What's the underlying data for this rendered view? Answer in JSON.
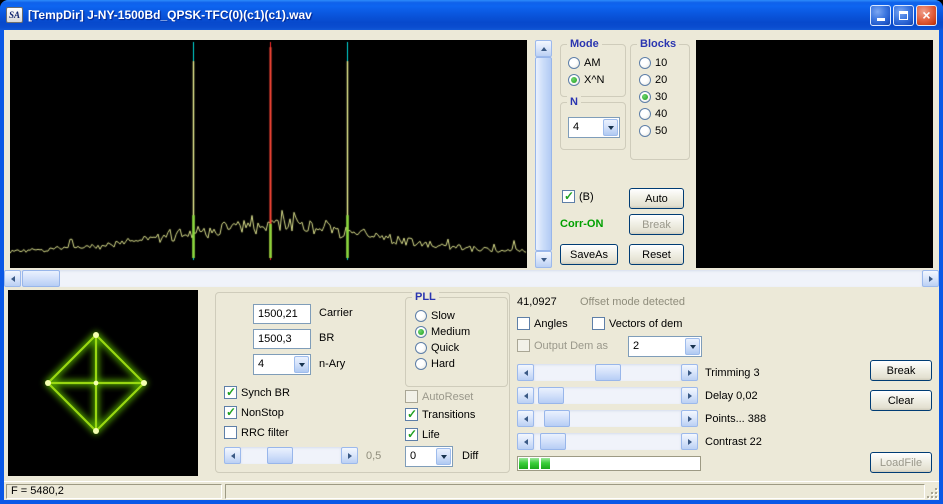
{
  "window": {
    "icon_text": "SA",
    "title": "[TempDir] J-NY-1500Bd_QPSK-TFC(0)(c1)(c1).wav"
  },
  "top": {
    "mode": {
      "label": "Mode",
      "options": [
        {
          "label": "AM",
          "selected": false
        },
        {
          "label": "X^N",
          "selected": true
        }
      ]
    },
    "blocks": {
      "label": "Blocks",
      "options": [
        {
          "label": "10",
          "selected": false
        },
        {
          "label": "20",
          "selected": false
        },
        {
          "label": "30",
          "selected": true
        },
        {
          "label": "40",
          "selected": false
        },
        {
          "label": "50",
          "selected": false
        }
      ]
    },
    "n": {
      "label": "N",
      "value": "4"
    },
    "b_checkbox": {
      "label": "(B)",
      "checked": true
    },
    "auto_button": "Auto",
    "corr_status": "Corr-ON",
    "break_button": "Break",
    "saveas_button": "SaveAs",
    "reset_button": "Reset"
  },
  "spectrum": {
    "background": "#000000",
    "trace_color": "#D8DD8A",
    "markers": [
      {
        "x_frac": 0.354,
        "color": "#00D8D8"
      },
      {
        "x_frac": 0.503,
        "color": "#FF2A2A"
      },
      {
        "x_frac": 0.652,
        "color": "#00D8D8"
      }
    ],
    "peaks": [
      {
        "x_frac": 0.354,
        "h_frac": 0.92,
        "color": "#E8EE90",
        "width": 1.5
      },
      {
        "x_frac": 0.652,
        "h_frac": 0.92,
        "color": "#E8EE90",
        "width": 1.5
      },
      {
        "x_frac": 0.503,
        "h_frac": 0.985,
        "color": "#FF4838",
        "width": 2
      },
      {
        "x_frac": 0.354,
        "h_frac": 0.2,
        "color": "#8ADA3C",
        "width": 2.5
      },
      {
        "x_frac": 0.652,
        "h_frac": 0.2,
        "color": "#8ADA3C",
        "width": 2.5
      },
      {
        "x_frac": 0.503,
        "h_frac": 0.16,
        "color": "#8ADA3C",
        "width": 2.5
      }
    ]
  },
  "demod": {
    "carrier": {
      "value": "1500,21",
      "label": "Carrier"
    },
    "br": {
      "value": "1500,3",
      "label": "BR"
    },
    "nary": {
      "value": "4",
      "label": "n-Ary"
    },
    "synch_br": {
      "label": "Synch BR",
      "checked": true
    },
    "nonstop": {
      "label": "NonStop",
      "checked": true
    },
    "rrc": {
      "label": "RRC filter",
      "checked": false
    },
    "gain_slider": {
      "value_label": "0,5",
      "thumb_frac": 0.35
    },
    "pll": {
      "label": "PLL",
      "options": [
        {
          "label": "Slow",
          "selected": false
        },
        {
          "label": "Medium",
          "selected": true
        },
        {
          "label": "Quick",
          "selected": false
        },
        {
          "label": "Hard",
          "selected": false
        }
      ]
    },
    "autoreset": {
      "label": "AutoReset",
      "checked": false,
      "disabled": true
    },
    "transitions": {
      "label": "Transitions",
      "checked": true
    },
    "life": {
      "label": "Life",
      "checked": true
    },
    "diff": {
      "value": "0",
      "label": "Diff"
    }
  },
  "right": {
    "offset_value": "41,0927",
    "offset_note": "Offset mode detected",
    "angles": {
      "label": "Angles",
      "checked": false
    },
    "vectors": {
      "label": "Vectors of dem",
      "checked": false
    },
    "output_dem": {
      "label": "Output Dem as",
      "value": "2",
      "disabled": true
    },
    "sliders": [
      {
        "label": "Trimming 3",
        "thumb_frac": 0.5
      },
      {
        "label": "Delay  0,02",
        "thumb_frac": 0.03
      },
      {
        "label": "Points... 388",
        "thumb_frac": 0.08
      },
      {
        "label": "Contrast 22",
        "thumb_frac": 0.05
      }
    ],
    "progress_blocks": 3,
    "break_button": "Break",
    "clear_button": "Clear",
    "loadfile_button": "LoadFile"
  },
  "statusbar": {
    "f_value": "F = 5480,2"
  }
}
